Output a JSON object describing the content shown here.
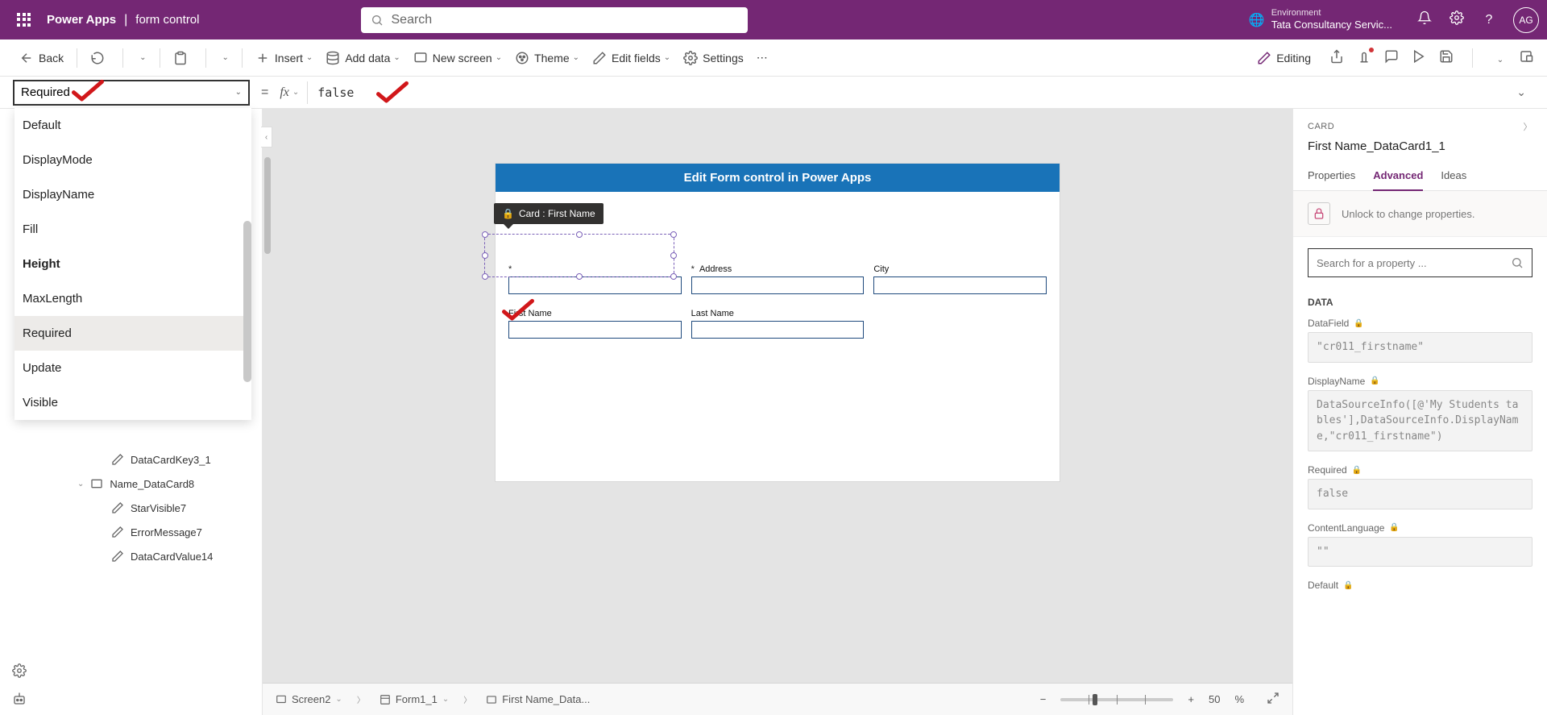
{
  "header": {
    "app": "Power Apps",
    "file": "form control",
    "search_placeholder": "Search",
    "env_label": "Environment",
    "env_name": "Tata Consultancy Servic...",
    "avatar": "AG"
  },
  "toolbar": {
    "back": "Back",
    "insert": "Insert",
    "add_data": "Add data",
    "new_screen": "New screen",
    "theme": "Theme",
    "edit_fields": "Edit fields",
    "settings": "Settings",
    "editing": "Editing"
  },
  "formula": {
    "property": "Required",
    "value": "false"
  },
  "property_dropdown": {
    "items": [
      "Default",
      "DisplayMode",
      "DisplayName",
      "Fill",
      "Height",
      "MaxLength",
      "Required",
      "Update",
      "Visible"
    ],
    "bold": "Height",
    "highlighted": "Required"
  },
  "tree": {
    "items": [
      {
        "label": "DataCardKey3_1",
        "indent": "leaf"
      },
      {
        "label": "Name_DataCard8",
        "indent": "parent"
      },
      {
        "label": "StarVisible7",
        "indent": "leaf"
      },
      {
        "label": "ErrorMessage7",
        "indent": "leaf"
      },
      {
        "label": "DataCardValue14",
        "indent": "leaf"
      }
    ]
  },
  "canvas": {
    "screen_title": "Edit Form control in Power Apps",
    "fields_row1": [
      {
        "label": "",
        "required": true
      },
      {
        "label": "Address",
        "required": true
      },
      {
        "label": "City",
        "required": false
      }
    ],
    "fields_row2": [
      {
        "label": "First Name",
        "required": false
      },
      {
        "label": "Last Name",
        "required": false
      }
    ],
    "tooltip": "Card : First Name"
  },
  "breadcrumbs": {
    "items": [
      "Screen2",
      "Form1_1",
      "First Name_Data..."
    ]
  },
  "zoom": {
    "value": "50",
    "unit": "%"
  },
  "right": {
    "type": "CARD",
    "name": "First Name_DataCard1_1",
    "tabs": [
      "Properties",
      "Advanced",
      "Ideas"
    ],
    "active_tab": "Advanced",
    "lock_text": "Unlock to change properties.",
    "search_placeholder": "Search for a property ...",
    "section": "DATA",
    "fields": {
      "DataField": {
        "label": "DataField",
        "value": "\"cr011_firstname\""
      },
      "DisplayName": {
        "label": "DisplayName",
        "value": "DataSourceInfo([@'My Students tables'],DataSourceInfo.DisplayName,\"cr011_firstname\")"
      },
      "Required": {
        "label": "Required",
        "value": "false"
      },
      "ContentLanguage": {
        "label": "ContentLanguage",
        "value": "\"\""
      },
      "Default": {
        "label": "Default",
        "value": ""
      }
    }
  }
}
